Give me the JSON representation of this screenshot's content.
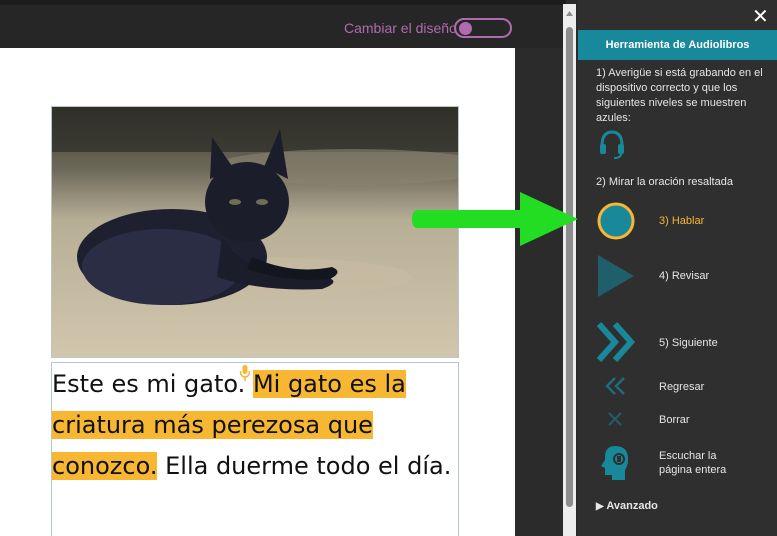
{
  "toolbar": {
    "layout_toggle_label": "Cambiar el diseño"
  },
  "story": {
    "part1": "Este es mi gato.",
    "part2": "Mi gato es la",
    "part3": "criatura más perezosa que",
    "part4": "conozco.",
    "part5": "Ella duerme todo el día."
  },
  "audio_panel": {
    "title": "Herramienta de Audiolibros",
    "step1": "1) Averigüe si está grabando en el dispositivo correcto y que los siguientes niveles se muestren azules:",
    "step2": "2) Mirar la oración resaltada",
    "speak_label": "3) Hablar",
    "review_label": "4) Revisar",
    "next_label": "5) Siguiente",
    "back_label": "Regresar",
    "delete_label": "Borrar",
    "listen_label_1": "Escuchar la",
    "listen_label_2": "página entera",
    "advanced_label": "Avanzado",
    "close_symbol": "✕",
    "advanced_marker": "▶"
  },
  "colors": {
    "accent": "#17899a",
    "highlight": "#f7b733",
    "toggle": "#b06bb0",
    "arrow": "#22dd22"
  }
}
